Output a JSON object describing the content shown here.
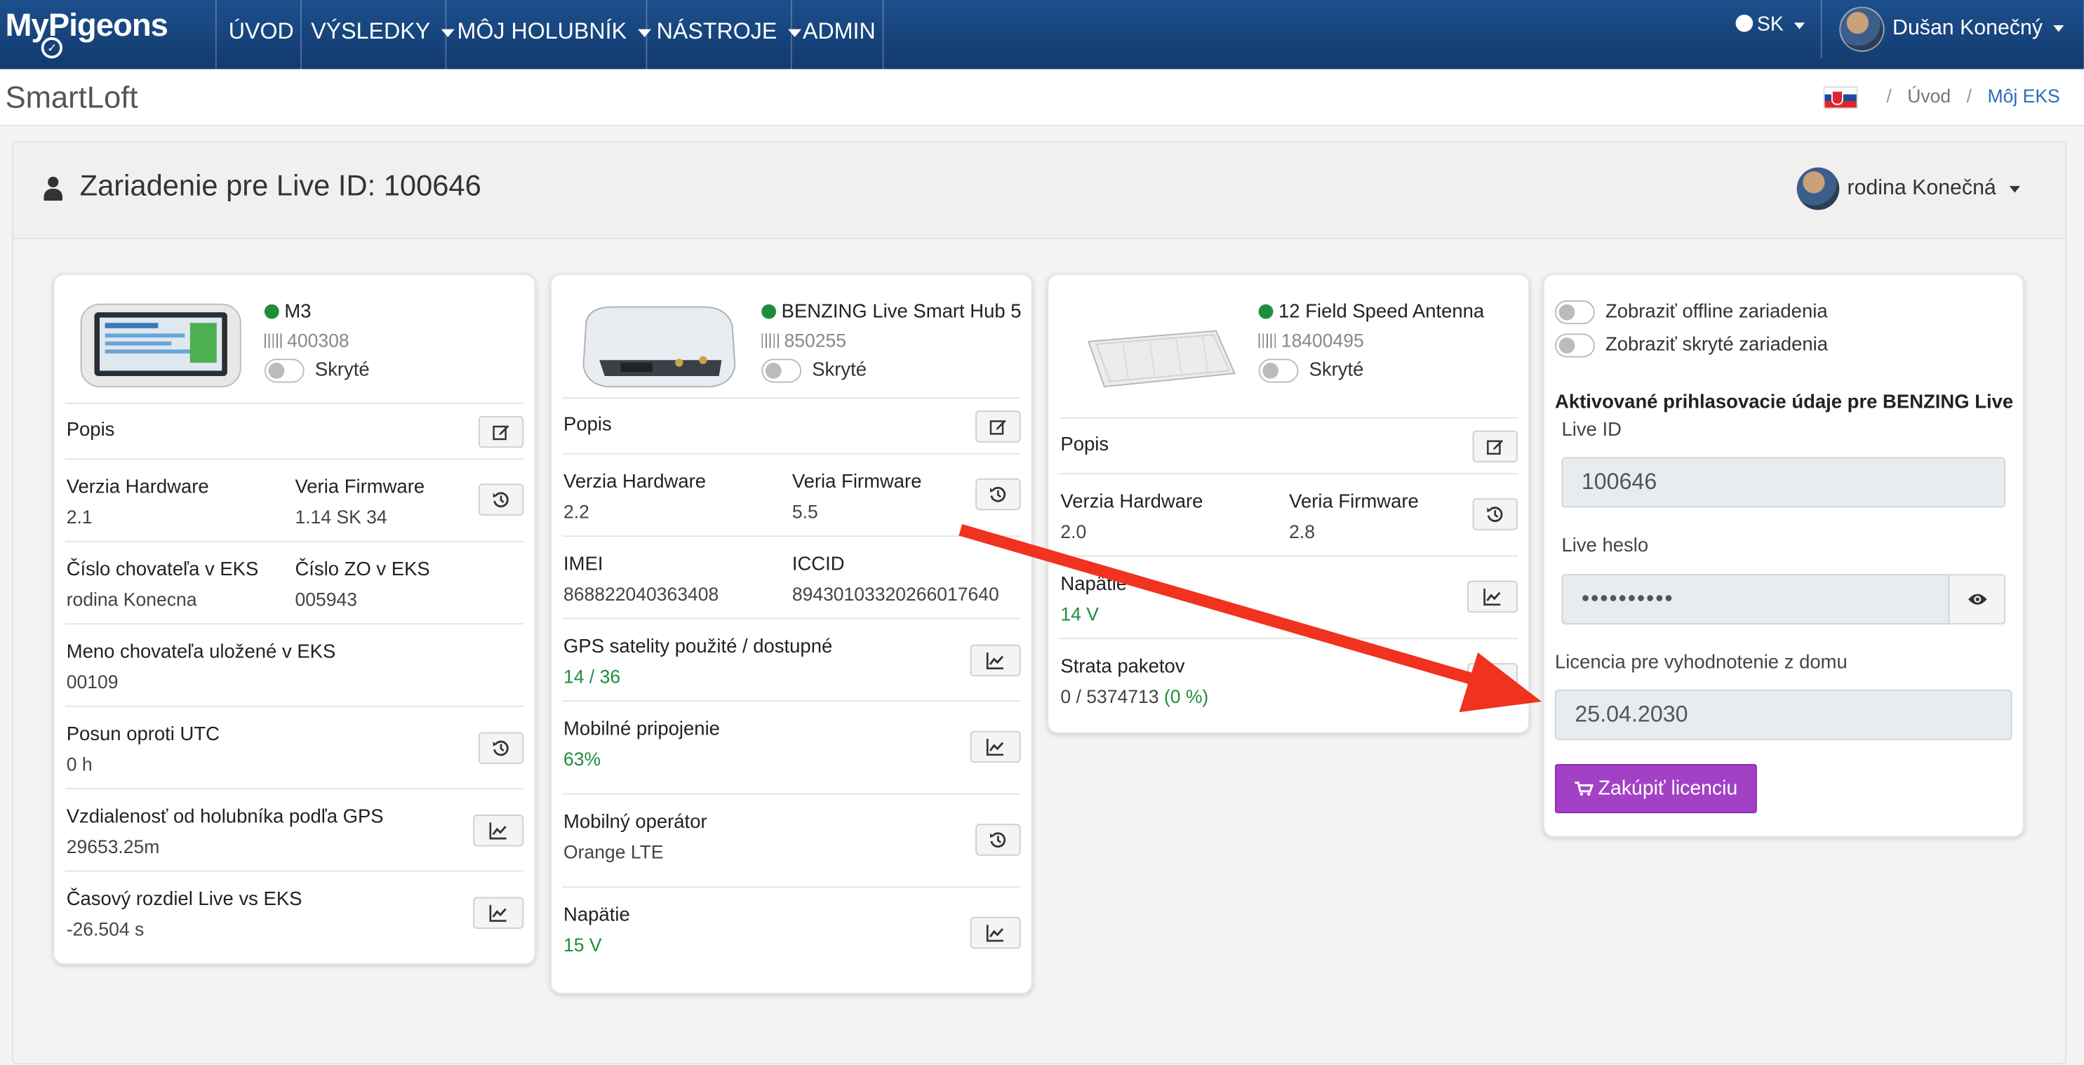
{
  "nav": {
    "logo": "MyPigeons",
    "items": [
      {
        "label": "ÚVOD",
        "dropdown": false
      },
      {
        "label": "VÝSLEDKY",
        "dropdown": true
      },
      {
        "label": "MÔJ HOLUBNÍK",
        "dropdown": true
      },
      {
        "label": "NÁSTROJE",
        "dropdown": true
      },
      {
        "label": "ADMIN",
        "dropdown": false
      }
    ],
    "language": "SK",
    "user": "Dušan Konečný"
  },
  "titlebar": {
    "title": "SmartLoft",
    "breadcrumb": [
      "Úvod",
      "Môj EKS"
    ]
  },
  "panel": {
    "title": "Zariadenie pre Live ID: 100646",
    "group": "rodina Konečná"
  },
  "devices": [
    {
      "name": "M3",
      "id": "400308",
      "hidden_label": "Skryté",
      "status_color": "#1e8e3e",
      "desc_label": "Popis",
      "hw_label": "Verzia Hardware",
      "hw": "2.1",
      "fw_label": "Veria Firmware",
      "fw": "1.14 SK 34",
      "breeder_no_label": "Číslo chovateľa v EKS",
      "breeder_no": "rodina Konecna",
      "zo_label": "Číslo ZO v EKS",
      "zo": "005943",
      "breeder_name_label": "Meno chovateľa uložené v EKS",
      "breeder_name": "00109",
      "utc_label": "Posun oproti UTC",
      "utc": "0 h",
      "dist_label": "Vzdialenosť od holubníka podľa GPS",
      "dist": "29653.25m",
      "diff_label": "Časový rozdiel Live vs EKS",
      "diff": "-26.504 s"
    },
    {
      "name": "BENZING Live Smart Hub 5",
      "id": "850255",
      "hidden_label": "Skryté",
      "desc_label": "Popis",
      "hw_label": "Verzia Hardware",
      "hw": "2.2",
      "fw_label": "Veria Firmware",
      "fw": "5.5",
      "imei_label": "IMEI",
      "imei": "868822040363408",
      "iccid_label": "ICCID",
      "iccid": "89430103320266017640",
      "gps_label": "GPS satelity použité / dostupné",
      "gps": "14 / 36",
      "mobile_label": "Mobilné pripojenie",
      "mobile": "63%",
      "operator_label": "Mobilný operátor",
      "operator": "Orange LTE",
      "voltage_label": "Napätie",
      "voltage": "15 V"
    },
    {
      "name": "12 Field Speed Antenna",
      "id": "18400495",
      "hidden_label": "Skryté",
      "desc_label": "Popis",
      "hw_label": "Verzia Hardware",
      "hw": "2.0",
      "fw_label": "Veria Firmware",
      "fw": "2.8",
      "voltage_label": "Napätie",
      "voltage": "14 V",
      "loss_label": "Strata paketov",
      "loss": "0 / 5374713",
      "loss_pct": "(0 %)"
    }
  ],
  "settings": {
    "show_offline": "Zobraziť offline zariadenia",
    "show_hidden": "Zobraziť skryté zariadenia",
    "credentials_title": "Aktivované prihlasovacie údaje pre BENZING Live",
    "live_id_label": "Live ID",
    "live_id": "100646",
    "password_label": "Live heslo",
    "password": "••••••••••",
    "license_label": "Licencia pre vyhodnotenie z domu",
    "license_date": "25.04.2030",
    "buy_button": "Zakúpiť licenciu"
  },
  "colors": {
    "nav_bg": "#123a6e",
    "status_ok": "#1e8e3e",
    "buy_button": "#a341c6",
    "annotation_arrow": "#f0321e"
  }
}
